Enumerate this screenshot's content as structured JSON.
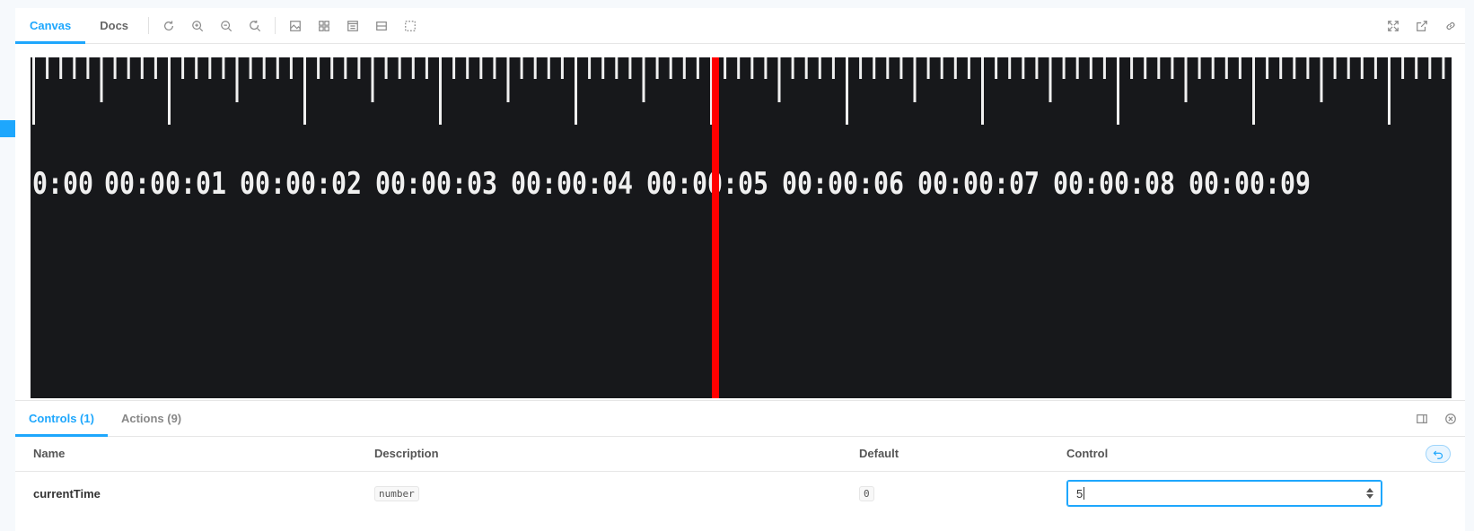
{
  "toolbar": {
    "tabs": [
      {
        "label": "Canvas",
        "active": true
      },
      {
        "label": "Docs",
        "active": false
      }
    ],
    "tools": [
      "reload-icon",
      "zoom-in-icon",
      "zoom-out-icon",
      "reset-zoom-icon",
      "background-icon",
      "grid-icon",
      "viewport-icon",
      "measure-icon",
      "outline-icon"
    ],
    "right_tools": [
      "fullscreen-icon",
      "open-new-tab-icon",
      "copy-link-icon"
    ]
  },
  "preview": {
    "timecodes": [
      "0:00",
      "00:00:01",
      "00:00:02",
      "00:00:03",
      "00:00:04",
      "00:00:05",
      "00:00:06",
      "00:00:07",
      "00:00:08",
      "00:00:09"
    ],
    "playhead_time_seconds": 5,
    "colors": {
      "background": "#17181b",
      "ticks": "#f0f0f0",
      "playhead": "#ff0000"
    }
  },
  "panel": {
    "tabs": [
      {
        "label": "Controls (1)",
        "active": true
      },
      {
        "label": "Actions (9)",
        "active": false
      }
    ],
    "columns": {
      "name": "Name",
      "description": "Description",
      "default": "Default",
      "control": "Control"
    },
    "rows": [
      {
        "name": "currentTime",
        "type": "number",
        "default": "0",
        "value": "5"
      }
    ]
  },
  "accent_color": "#1ea7fd"
}
